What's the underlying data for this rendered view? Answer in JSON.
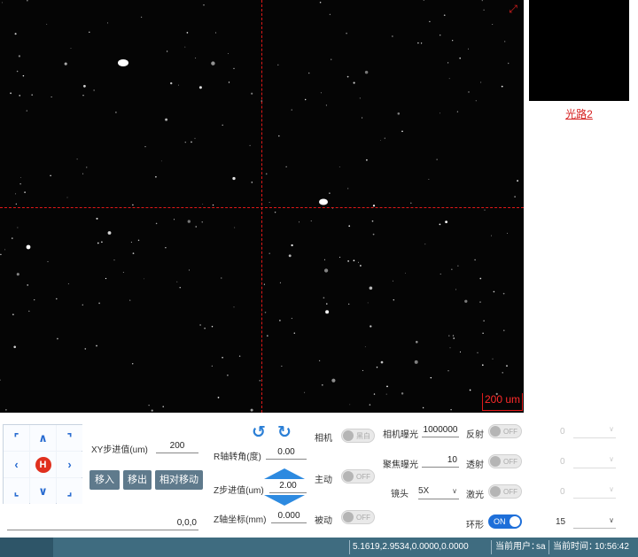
{
  "viewport": {
    "scale_bar_label": "200 um",
    "expand_icon": "expand-arrows-icon"
  },
  "side_panel": {
    "light_path_link": "光路2"
  },
  "dpad": {
    "home_label": "H",
    "icons": [
      "arrow-up-left-icon",
      "arrow-up-icon",
      "arrow-up-right-icon",
      "arrow-left-icon",
      "home-icon",
      "arrow-right-icon",
      "arrow-down-left-icon",
      "arrow-down-icon",
      "arrow-down-right-icon"
    ]
  },
  "xy": {
    "step_label": "XY步进值(um)",
    "step_value": "200",
    "move_in": "移入",
    "move_out": "移出",
    "relative_move": "相对移动",
    "coordinates": "0,0,0"
  },
  "r_axis": {
    "angle_label": "R轴转角(度)",
    "angle_value": "0.00"
  },
  "z_axis": {
    "step_label": "Z步进值(um)",
    "step_value": "2.00",
    "coord_label": "Z轴坐标(mm)",
    "coord_value": "0.000"
  },
  "modes": {
    "camera_label": "相机",
    "camera_toggle": "黑白",
    "active_label": "主动",
    "active_toggle": "OFF",
    "passive_label": "被动",
    "passive_toggle": "OFF"
  },
  "exposure": {
    "camera_label": "相机曝光",
    "camera_value": "1000000",
    "focus_label": "聚焦曝光",
    "focus_value": "10",
    "lens_label": "镜头",
    "lens_value": "5X"
  },
  "lights": {
    "reflect_label": "反射",
    "reflect_toggle": "OFF",
    "reflect_value": "0",
    "transmit_label": "透射",
    "transmit_toggle": "OFF",
    "transmit_value": "0",
    "laser_label": "激光",
    "laser_toggle": "OFF",
    "laser_value": "0",
    "ring_label": "环形",
    "ring_toggle": "ON",
    "ring_value": "15"
  },
  "status_bar": {
    "position": "5.1619,2.9534,0.0000,0.0000",
    "user_label": "当前用户：",
    "user": "sa",
    "time_label": "当前时间：",
    "time": "10:56:42"
  },
  "colors": {
    "crosshair": "#e01818",
    "status_bar": "#3f6c80",
    "toggle_on": "#1e6fd9",
    "action_button": "#5f7a8c"
  }
}
